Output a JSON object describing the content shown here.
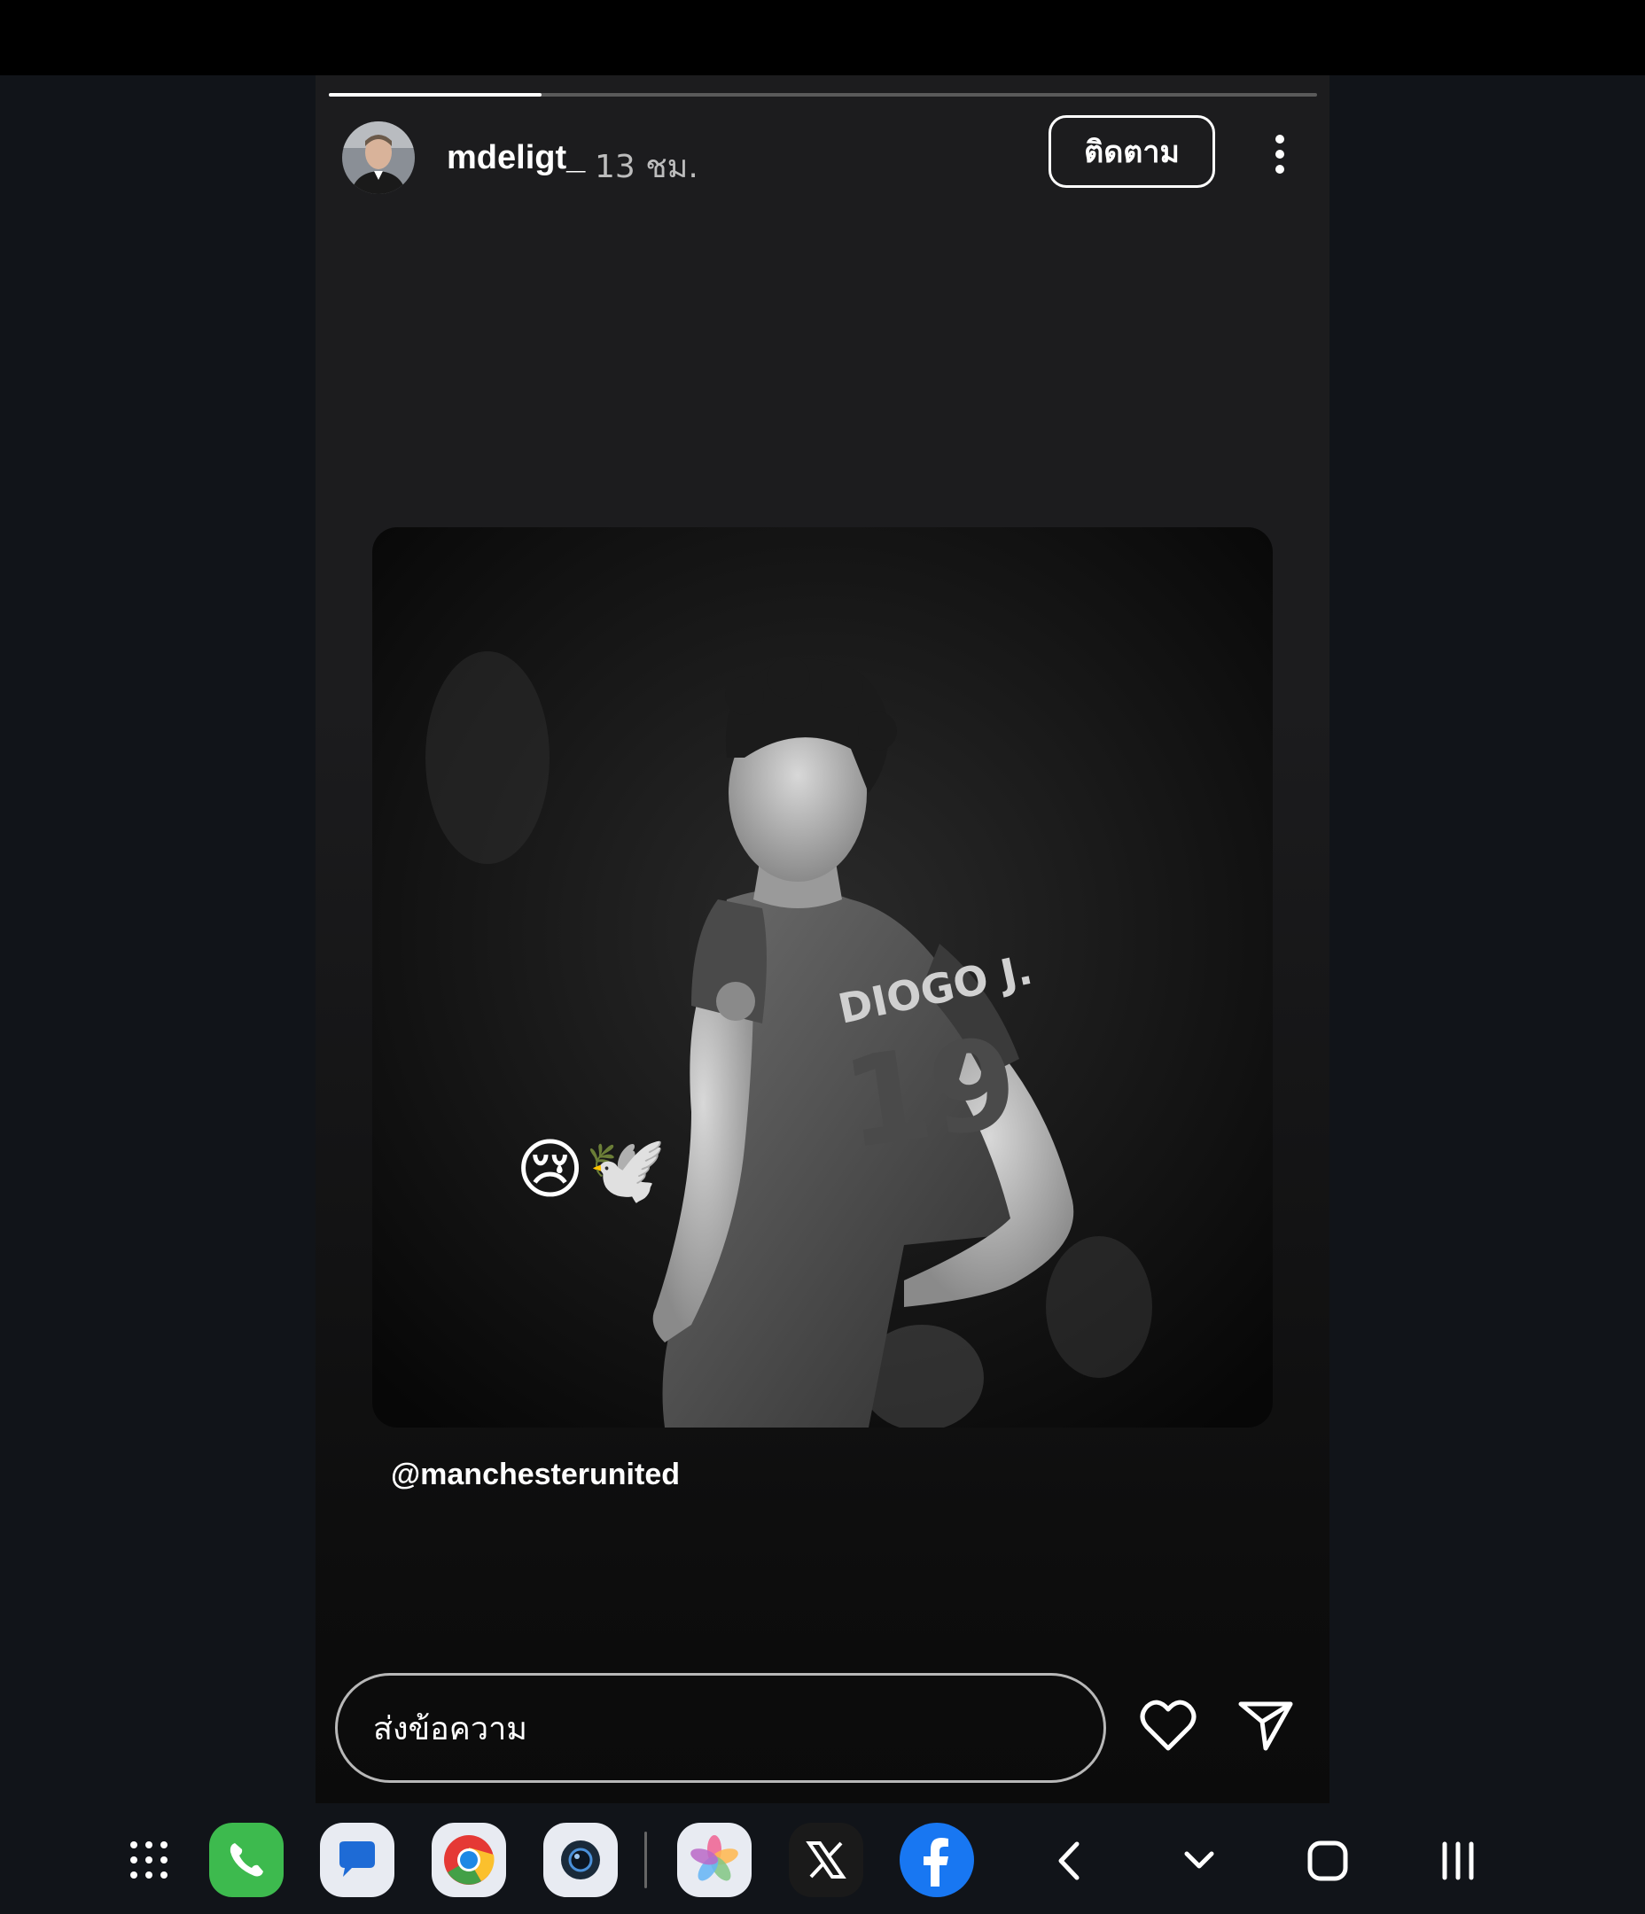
{
  "story": {
    "progress_fraction": 0.215,
    "username": "mdeligt_",
    "time": "13 ชม.",
    "follow_label": "ติดตาม",
    "emojis": [
      "😢",
      "🕊️"
    ],
    "jersey_name": "DIOGO J.",
    "mention": "@manchesterunited",
    "reply_placeholder": "ส่งข้อความ"
  },
  "colors": {
    "background": "#111419",
    "story_bg": "#1c1c1e",
    "phone_green": "#3dba4e",
    "facebook_blue": "#1877f2"
  },
  "dock": {
    "apps": [
      "app-drawer-icon",
      "phone-icon",
      "messages-icon",
      "chrome-icon",
      "camera-icon",
      "photos-icon",
      "x-icon",
      "facebook-icon"
    ],
    "nav": [
      "back-icon",
      "hide-keyboard-icon",
      "home-icon",
      "recents-icon"
    ]
  }
}
